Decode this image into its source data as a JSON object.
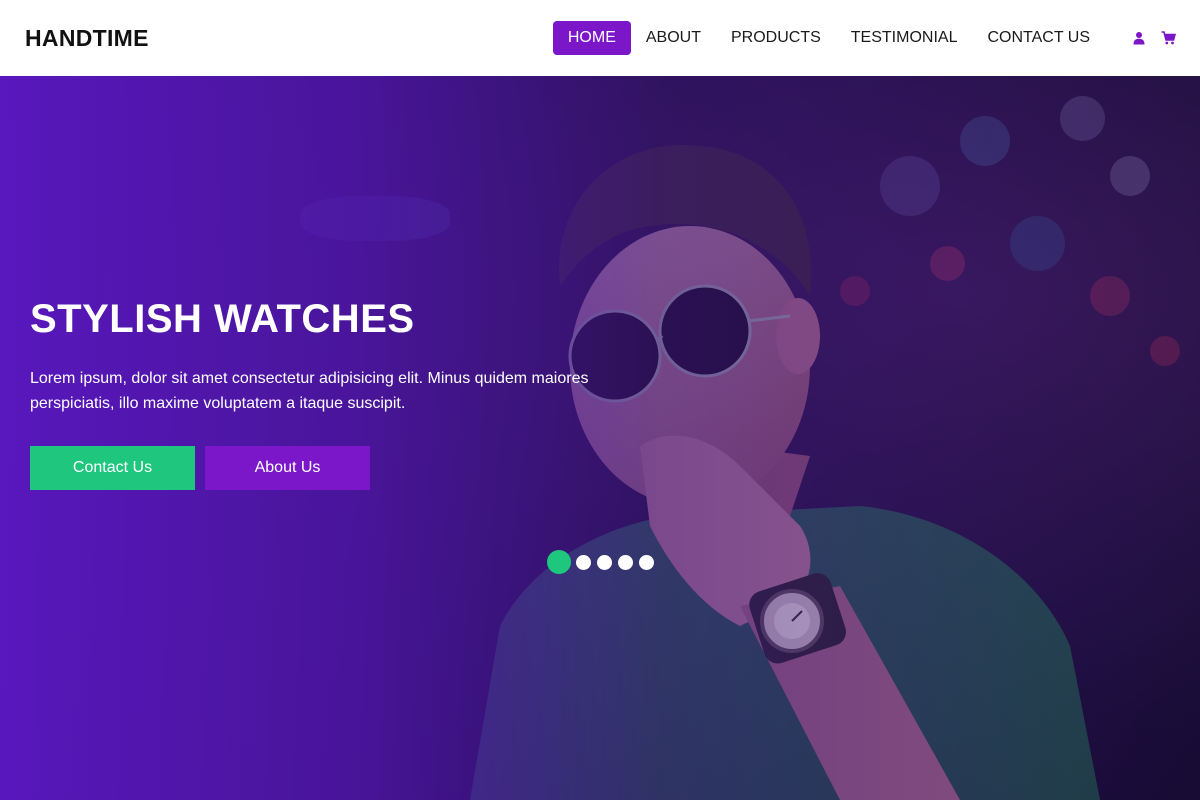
{
  "brand": "HANDTIME",
  "nav": {
    "items": [
      {
        "label": "HOME",
        "active": true
      },
      {
        "label": "ABOUT",
        "active": false
      },
      {
        "label": "PRODUCTS",
        "active": false
      },
      {
        "label": "TESTIMONIAL",
        "active": false
      },
      {
        "label": "CONTACT US",
        "active": false
      }
    ],
    "icons": [
      "user-icon",
      "cart-icon"
    ]
  },
  "hero": {
    "title": "STYLISH WATCHES",
    "text": "Lorem ipsum, dolor sit amet consectetur adipisicing elit. Minus quidem maiores perspiciatis, illo maxime voluptatem a itaque suscipit.",
    "buttons": {
      "contact": "Contact Us",
      "about": "About Us"
    },
    "slider": {
      "count": 5,
      "active_index": 0
    }
  },
  "colors": {
    "accent_purple": "#7b16c9",
    "accent_green": "#1fc67e"
  }
}
